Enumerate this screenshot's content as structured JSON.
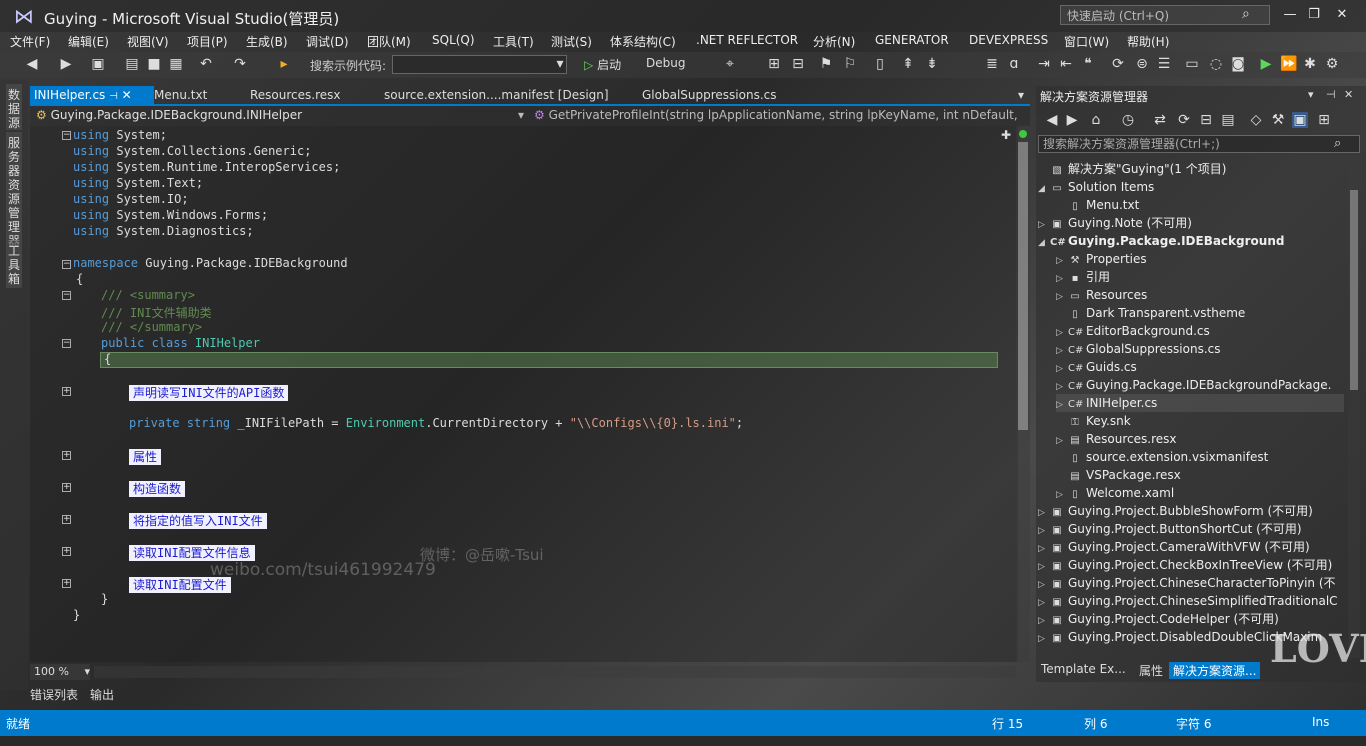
{
  "window": {
    "title": "Guying - Microsoft Visual Studio(管理员)",
    "quick_launch_placeholder": "快速启动 (Ctrl+Q)"
  },
  "menu": [
    "文件(F)",
    "编辑(E)",
    "视图(V)",
    "项目(P)",
    "生成(B)",
    "调试(D)",
    "团队(M)",
    "SQL(Q)",
    "工具(T)",
    "测试(S)",
    "体系结构(C)",
    ".NET REFLECTOR",
    "分析(N)",
    "GENERATOR",
    "DEVEXPRESS",
    "窗口(W)",
    "帮助(H)"
  ],
  "toolbar": {
    "search_label": "搜索示例代码:",
    "start_label": "启动",
    "config": "Debug"
  },
  "left_dock": [
    "数据源",
    "服务器资源管理器",
    "工具箱"
  ],
  "tabs": [
    "INIHelper.cs",
    "Menu.txt",
    "Resources.resx",
    "source.extension....manifest [Design]",
    "GlobalSuppressions.cs"
  ],
  "nav": {
    "left": "Guying.Package.IDEBackground.INIHelper",
    "right": "GetPrivateProfileInt(string lpApplicationName, string lpKeyName, int nDefault, st"
  },
  "code": {
    "usings": [
      {
        "kw": "using",
        "ns": " System;"
      },
      {
        "kw": "using",
        "ns": " System.Collections.Generic;"
      },
      {
        "kw": "using",
        "ns": " System.Runtime.InteropServices;"
      },
      {
        "kw": "using",
        "ns": " System.Text;"
      },
      {
        "kw": "using",
        "ns": " System.IO;"
      },
      {
        "kw": "using",
        "ns": " System.Windows.Forms;"
      },
      {
        "kw": "using",
        "ns": " System.Diagnostics;"
      }
    ],
    "ns_kw": "namespace",
    "ns_name": " Guying.Package.IDEBackground",
    "open_brace": "{",
    "summary_open": "/// <summary>",
    "summary_text": "/// INI文件辅助类",
    "summary_close": "/// </summary>",
    "class_mods": "public class",
    "class_name": " INIHelper",
    "class_brace": "{",
    "regions": [
      "声明读写INI文件的API函数",
      "属性",
      "构造函数",
      "将指定的值写入INI文件",
      "读取INI配置文件信息",
      "读取INI配置文件"
    ],
    "field_mods": "private string",
    "field_name": " _INIFilePath = ",
    "field_type": "Environment",
    "field_rest": ".CurrentDirectory + ",
    "field_str": "\"\\\\Configs\\\\{0}.ls.ini\"",
    "field_end": ";",
    "close1": "}",
    "close2": "}"
  },
  "zoom": "100 %",
  "bottom_tabs": [
    "错误列表",
    "输出"
  ],
  "solution_explorer": {
    "title": "解决方案资源管理器",
    "search_placeholder": "搜索解决方案资源管理器(Ctrl+;)",
    "items": [
      {
        "label": "解决方案\"Guying\"(1 个项目)",
        "bold": false
      },
      {
        "label": "Solution Items",
        "bold": false
      },
      {
        "label": "Menu.txt",
        "bold": false
      },
      {
        "label": "Guying.Note (不可用)",
        "bold": false
      },
      {
        "label": "Guying.Package.IDEBackground",
        "bold": true
      },
      {
        "label": "Properties",
        "bold": false
      },
      {
        "label": "引用",
        "bold": false
      },
      {
        "label": "Resources",
        "bold": false
      },
      {
        "label": "Dark Transparent.vstheme",
        "bold": false
      },
      {
        "label": "EditorBackground.cs",
        "bold": false
      },
      {
        "label": "GlobalSuppressions.cs",
        "bold": false
      },
      {
        "label": "Guids.cs",
        "bold": false
      },
      {
        "label": "Guying.Package.IDEBackgroundPackage.",
        "bold": false
      },
      {
        "label": "INIHelper.cs",
        "bold": false
      },
      {
        "label": "Key.snk",
        "bold": false
      },
      {
        "label": "Resources.resx",
        "bold": false
      },
      {
        "label": "source.extension.vsixmanifest",
        "bold": false
      },
      {
        "label": "VSPackage.resx",
        "bold": false
      },
      {
        "label": "Welcome.xaml",
        "bold": false
      },
      {
        "label": "Guying.Project.BubbleShowForm (不可用)",
        "bold": false
      },
      {
        "label": "Guying.Project.ButtonShortCut (不可用)",
        "bold": false
      },
      {
        "label": "Guying.Project.CameraWithVFW (不可用)",
        "bold": false
      },
      {
        "label": "Guying.Project.CheckBoxInTreeView (不可用)",
        "bold": false
      },
      {
        "label": "Guying.Project.ChineseCharacterToPinyin (不",
        "bold": false
      },
      {
        "label": "Guying.Project.ChineseSimplifiedTraditionalC",
        "bold": false
      },
      {
        "label": "Guying.Project.CodeHelper (不可用)",
        "bold": false
      },
      {
        "label": "Guying.Project.DisabledDoubleClickMaxim",
        "bold": false
      }
    ],
    "tabs": [
      "Template Ex...",
      "属性",
      "解决方案资源..."
    ]
  },
  "status": {
    "ready": "就绪",
    "line": "行 15",
    "col": "列 6",
    "char": "字符 6",
    "ins": "Ins"
  },
  "watermark": {
    "weibo": "微博：@岳嗽-Tsui",
    "url": "weibo.com/tsui461992479"
  },
  "love": "LOVE"
}
